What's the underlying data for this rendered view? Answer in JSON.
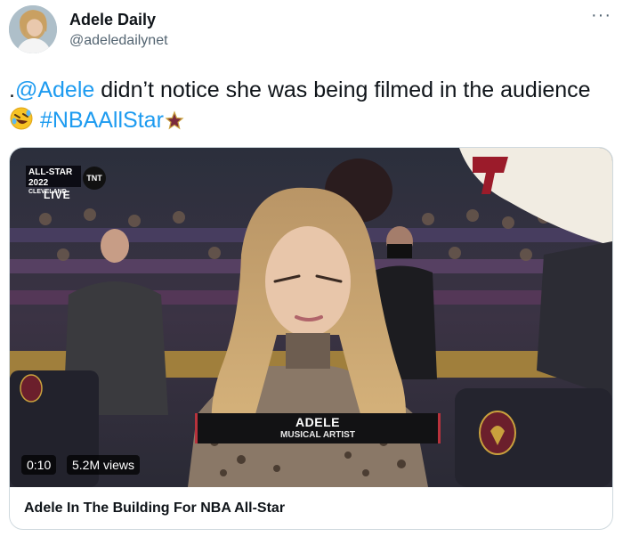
{
  "author": {
    "display_name": "Adele Daily",
    "handle": "@adeledailynet",
    "avatar_icon": "profile-photo"
  },
  "more_options_icon": "more-horizontal-icon",
  "tweet": {
    "prefix": ".",
    "mention": "@Adele",
    "text": " didn’t notice she was being filmed in the audience ",
    "emoji_icon": "rolling-on-floor-laughing-emoji",
    "hashtag": "#NBAAllStar",
    "trailing_icon": "star-icon"
  },
  "video": {
    "broadcast_logo": {
      "line1": "ALL-STAR 2022",
      "line2": "CLEVELAND",
      "network": "TNT",
      "live_label": "LIVE"
    },
    "lower_third": {
      "name": "ADELE",
      "role": "MUSICAL ARTIST"
    },
    "seat_logo_text": "CLEVELAND CAVALIERS",
    "elapsed": "0:10",
    "views": "5.2M views"
  },
  "card": {
    "title": "Adele In The Building For NBA All-Star"
  },
  "colors": {
    "link": "#1d9bf0",
    "text": "#0f1419",
    "secondary": "#536471",
    "border": "#cfd9de",
    "accent_red": "#b8323c"
  }
}
